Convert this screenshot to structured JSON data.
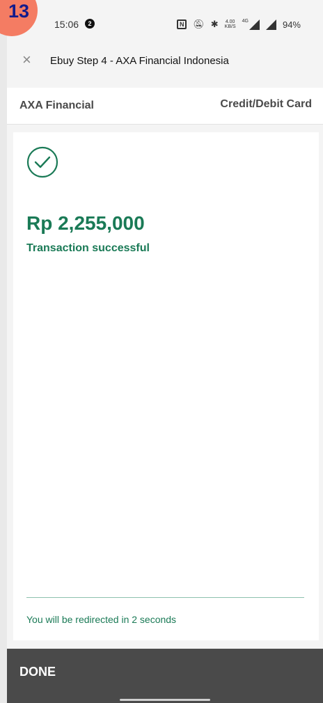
{
  "step_badge": "13",
  "status_bar": {
    "time": "15:06",
    "notification_count": "2",
    "net_speed_value": "4.00",
    "net_speed_unit": "KB/S",
    "network_type": "4G",
    "battery": "94%"
  },
  "browser": {
    "close_label": "×",
    "page_title": "Ebuy Step 4 - AXA Financial Indonesia"
  },
  "merchant": {
    "name": "AXA Financial",
    "payment_method": "Credit/Debit Card"
  },
  "result": {
    "amount": "Rp 2,255,000",
    "status": "Transaction successful",
    "redirect_message": "You will be redirected in 2 seconds"
  },
  "footer": {
    "done_label": "DONE"
  },
  "colors": {
    "success_green": "#1a7a56",
    "done_bar": "#4a4a4a",
    "badge": "#f47c63"
  }
}
